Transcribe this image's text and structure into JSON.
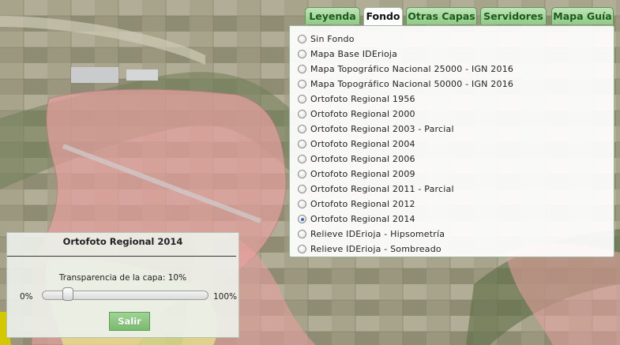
{
  "tabs": [
    {
      "label": "Leyenda",
      "active": false
    },
    {
      "label": "Fondo",
      "active": true
    },
    {
      "label": "Otras Capas",
      "active": false
    },
    {
      "label": "Servidores",
      "active": false
    },
    {
      "label": "Mapa Guía",
      "active": false
    }
  ],
  "fondo": {
    "options": [
      {
        "label": "Sin Fondo",
        "checked": false
      },
      {
        "label": "Mapa Base IDErioja",
        "checked": false
      },
      {
        "label": "Mapa Topográfico Nacional 25000 - IGN 2016",
        "checked": false
      },
      {
        "label": "Mapa Topográfico Nacional 50000 - IGN 2016",
        "checked": false
      },
      {
        "label": "Ortofoto Regional 1956",
        "checked": false
      },
      {
        "label": "Ortofoto Regional 2000",
        "checked": false
      },
      {
        "label": "Ortofoto Regional 2003 - Parcial",
        "checked": false
      },
      {
        "label": "Ortofoto Regional 2004",
        "checked": false
      },
      {
        "label": "Ortofoto Regional 2006",
        "checked": false
      },
      {
        "label": "Ortofoto Regional 2009",
        "checked": false
      },
      {
        "label": "Ortofoto Regional 2011 - Parcial",
        "checked": false
      },
      {
        "label": "Ortofoto Regional 2012",
        "checked": false
      },
      {
        "label": "Ortofoto Regional 2014",
        "checked": true
      },
      {
        "label": "Relieve IDErioja - Hipsometría",
        "checked": false
      },
      {
        "label": "Relieve IDErioja - Sombreado",
        "checked": false
      }
    ]
  },
  "transparency": {
    "title": "Ortofoto Regional 2014",
    "label": "Transparencia de la capa: 10%",
    "min_label": "0%",
    "max_label": "100%",
    "value_fraction": 0.1,
    "button_label": "Salir"
  },
  "colors": {
    "tab_bg": "#8fcb86",
    "tab_text": "#1d5a1d",
    "overlay_pink": "#e8a0a0",
    "overlay_yellow": "#e8ea8a",
    "selected_radio": "#2d6fc2"
  }
}
